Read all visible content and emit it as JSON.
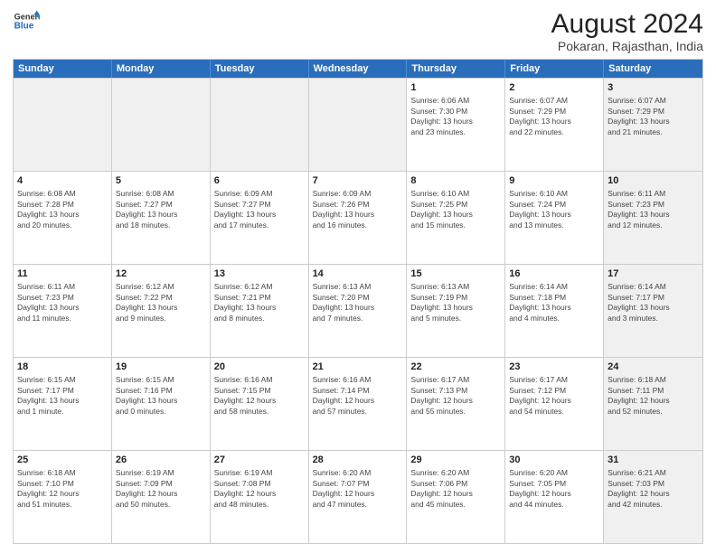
{
  "header": {
    "logo": {
      "line1": "General",
      "line2": "Blue"
    },
    "title": "August 2024",
    "subtitle": "Pokaran, Rajasthan, India"
  },
  "weekdays": [
    "Sunday",
    "Monday",
    "Tuesday",
    "Wednesday",
    "Thursday",
    "Friday",
    "Saturday"
  ],
  "rows": [
    [
      {
        "day": "",
        "info": "",
        "shaded": true
      },
      {
        "day": "",
        "info": "",
        "shaded": true
      },
      {
        "day": "",
        "info": "",
        "shaded": true
      },
      {
        "day": "",
        "info": "",
        "shaded": true
      },
      {
        "day": "1",
        "info": "Sunrise: 6:06 AM\nSunset: 7:30 PM\nDaylight: 13 hours\nand 23 minutes."
      },
      {
        "day": "2",
        "info": "Sunrise: 6:07 AM\nSunset: 7:29 PM\nDaylight: 13 hours\nand 22 minutes."
      },
      {
        "day": "3",
        "info": "Sunrise: 6:07 AM\nSunset: 7:29 PM\nDaylight: 13 hours\nand 21 minutes.",
        "shaded": true
      }
    ],
    [
      {
        "day": "4",
        "info": "Sunrise: 6:08 AM\nSunset: 7:28 PM\nDaylight: 13 hours\nand 20 minutes."
      },
      {
        "day": "5",
        "info": "Sunrise: 6:08 AM\nSunset: 7:27 PM\nDaylight: 13 hours\nand 18 minutes."
      },
      {
        "day": "6",
        "info": "Sunrise: 6:09 AM\nSunset: 7:27 PM\nDaylight: 13 hours\nand 17 minutes."
      },
      {
        "day": "7",
        "info": "Sunrise: 6:09 AM\nSunset: 7:26 PM\nDaylight: 13 hours\nand 16 minutes."
      },
      {
        "day": "8",
        "info": "Sunrise: 6:10 AM\nSunset: 7:25 PM\nDaylight: 13 hours\nand 15 minutes."
      },
      {
        "day": "9",
        "info": "Sunrise: 6:10 AM\nSunset: 7:24 PM\nDaylight: 13 hours\nand 13 minutes."
      },
      {
        "day": "10",
        "info": "Sunrise: 6:11 AM\nSunset: 7:23 PM\nDaylight: 13 hours\nand 12 minutes.",
        "shaded": true
      }
    ],
    [
      {
        "day": "11",
        "info": "Sunrise: 6:11 AM\nSunset: 7:23 PM\nDaylight: 13 hours\nand 11 minutes."
      },
      {
        "day": "12",
        "info": "Sunrise: 6:12 AM\nSunset: 7:22 PM\nDaylight: 13 hours\nand 9 minutes."
      },
      {
        "day": "13",
        "info": "Sunrise: 6:12 AM\nSunset: 7:21 PM\nDaylight: 13 hours\nand 8 minutes."
      },
      {
        "day": "14",
        "info": "Sunrise: 6:13 AM\nSunset: 7:20 PM\nDaylight: 13 hours\nand 7 minutes."
      },
      {
        "day": "15",
        "info": "Sunrise: 6:13 AM\nSunset: 7:19 PM\nDaylight: 13 hours\nand 5 minutes."
      },
      {
        "day": "16",
        "info": "Sunrise: 6:14 AM\nSunset: 7:18 PM\nDaylight: 13 hours\nand 4 minutes."
      },
      {
        "day": "17",
        "info": "Sunrise: 6:14 AM\nSunset: 7:17 PM\nDaylight: 13 hours\nand 3 minutes.",
        "shaded": true
      }
    ],
    [
      {
        "day": "18",
        "info": "Sunrise: 6:15 AM\nSunset: 7:17 PM\nDaylight: 13 hours\nand 1 minute."
      },
      {
        "day": "19",
        "info": "Sunrise: 6:15 AM\nSunset: 7:16 PM\nDaylight: 13 hours\nand 0 minutes."
      },
      {
        "day": "20",
        "info": "Sunrise: 6:16 AM\nSunset: 7:15 PM\nDaylight: 12 hours\nand 58 minutes."
      },
      {
        "day": "21",
        "info": "Sunrise: 6:16 AM\nSunset: 7:14 PM\nDaylight: 12 hours\nand 57 minutes."
      },
      {
        "day": "22",
        "info": "Sunrise: 6:17 AM\nSunset: 7:13 PM\nDaylight: 12 hours\nand 55 minutes."
      },
      {
        "day": "23",
        "info": "Sunrise: 6:17 AM\nSunset: 7:12 PM\nDaylight: 12 hours\nand 54 minutes."
      },
      {
        "day": "24",
        "info": "Sunrise: 6:18 AM\nSunset: 7:11 PM\nDaylight: 12 hours\nand 52 minutes.",
        "shaded": true
      }
    ],
    [
      {
        "day": "25",
        "info": "Sunrise: 6:18 AM\nSunset: 7:10 PM\nDaylight: 12 hours\nand 51 minutes."
      },
      {
        "day": "26",
        "info": "Sunrise: 6:19 AM\nSunset: 7:09 PM\nDaylight: 12 hours\nand 50 minutes."
      },
      {
        "day": "27",
        "info": "Sunrise: 6:19 AM\nSunset: 7:08 PM\nDaylight: 12 hours\nand 48 minutes."
      },
      {
        "day": "28",
        "info": "Sunrise: 6:20 AM\nSunset: 7:07 PM\nDaylight: 12 hours\nand 47 minutes."
      },
      {
        "day": "29",
        "info": "Sunrise: 6:20 AM\nSunset: 7:06 PM\nDaylight: 12 hours\nand 45 minutes."
      },
      {
        "day": "30",
        "info": "Sunrise: 6:20 AM\nSunset: 7:05 PM\nDaylight: 12 hours\nand 44 minutes."
      },
      {
        "day": "31",
        "info": "Sunrise: 6:21 AM\nSunset: 7:03 PM\nDaylight: 12 hours\nand 42 minutes.",
        "shaded": true
      }
    ]
  ]
}
